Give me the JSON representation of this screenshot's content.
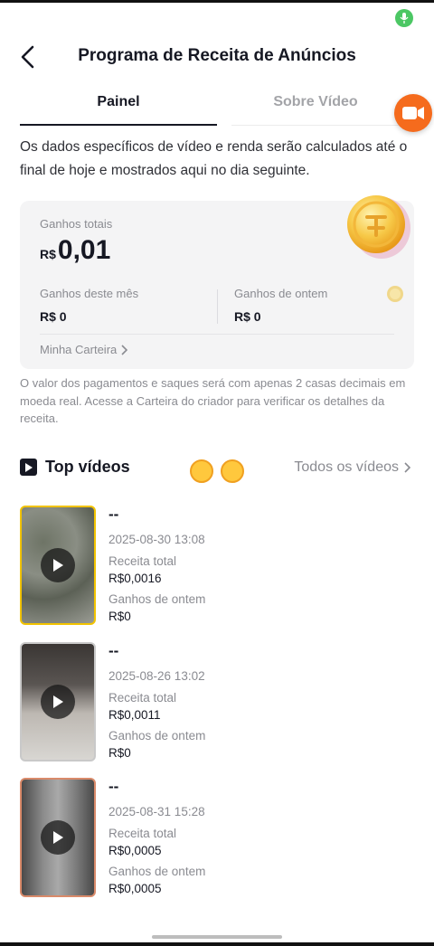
{
  "header": {
    "title": "Programa de Receita de Anúncios",
    "back_icon": "chevron-left-icon"
  },
  "tabs": [
    {
      "label": "Painel",
      "active": true
    },
    {
      "label": "Sobre Vídeo",
      "active": false
    }
  ],
  "intro": "Os dados específicos de vídeo e renda serão calculados até o final de hoje e mostrados aqui no dia seguinte.",
  "earnings": {
    "total_label": "Ganhos totais",
    "currency": "R$",
    "total_value": "0,01",
    "month_label": "Ganhos deste mês",
    "month_value": "R$ 0",
    "yesterday_label": "Ganhos de ontem",
    "yesterday_value": "R$ 0",
    "wallet_link": "Minha Carteira"
  },
  "note": "O valor dos pagamentos e saques será com apenas 2 casas decimais em moeda real. Acesse a Carteira do criador para verificar os detalhes da receita.",
  "top_videos": {
    "title": "Top vídeos",
    "all_link": "Todos os vídeos",
    "items": [
      {
        "title": "--",
        "date": "2025-08-30 13:08",
        "revenue_label": "Receita total",
        "revenue": "R$0,0016",
        "yesterday_label": "Ganhos de ontem",
        "yesterday": "R$0"
      },
      {
        "title": "--",
        "date": "2025-08-26 13:02",
        "revenue_label": "Receita total",
        "revenue": "R$0,0011",
        "yesterday_label": "Ganhos de ontem",
        "yesterday": "R$0"
      },
      {
        "title": "--",
        "date": "2025-08-31 15:28",
        "revenue_label": "Receita total",
        "revenue": "R$0,0005",
        "yesterday_label": "Ganhos de ontem",
        "yesterday": "R$0,0005"
      }
    ]
  },
  "colors": {
    "accent_orange": "#f56b1d",
    "mic_green": "#4cc764",
    "thumb_border_1": "#f2c300",
    "thumb_border_2": "#c9c9c9",
    "thumb_border_3": "#d98a6a"
  }
}
